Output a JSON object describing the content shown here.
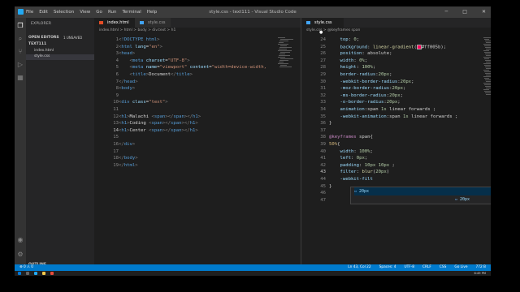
{
  "window": {
    "title": "style.css - text111 - Visual Studio Code",
    "menu": [
      "File",
      "Edit",
      "Selection",
      "View",
      "Go",
      "Run",
      "Terminal",
      "Help"
    ]
  },
  "sidebar": {
    "header": "EXPLORER",
    "open_editors": "OPEN EDITORS",
    "unsaved": "1 UNSAVED",
    "folder": "TEXT111",
    "files": [
      "index.html",
      "style.css"
    ],
    "outline": "OUTLINE"
  },
  "left_editor": {
    "tabs": [
      "index.html",
      "style.css"
    ],
    "breadcrumb": "index.html > html > body > div.text > h1",
    "lines": [
      {
        "n": "1",
        "parts": [
          [
            "punc",
            "<"
          ],
          [
            "tag",
            "!DOCTYPE html"
          ],
          [
            "punc",
            ">"
          ]
        ]
      },
      {
        "n": "2",
        "parts": [
          [
            "punc",
            "<"
          ],
          [
            "tag",
            "html "
          ],
          [
            "attr",
            "lang"
          ],
          [
            "plain",
            "="
          ],
          [
            "str",
            "\"en\""
          ],
          [
            "punc",
            ">"
          ]
        ]
      },
      {
        "n": "3",
        "parts": [
          [
            "punc",
            "<"
          ],
          [
            "tag",
            "head"
          ],
          [
            "punc",
            ">"
          ]
        ]
      },
      {
        "n": "4",
        "parts": [
          [
            "plain",
            "    "
          ],
          [
            "punc",
            "<"
          ],
          [
            "tag",
            "meta "
          ],
          [
            "attr",
            "charset"
          ],
          [
            "plain",
            "="
          ],
          [
            "str",
            "\"UTF-8\""
          ],
          [
            "punc",
            ">"
          ]
        ]
      },
      {
        "n": "5",
        "parts": [
          [
            "plain",
            "    "
          ],
          [
            "punc",
            "<"
          ],
          [
            "tag",
            "meta "
          ],
          [
            "attr",
            "name"
          ],
          [
            "plain",
            "="
          ],
          [
            "str",
            "\"viewport\""
          ],
          [
            "plain",
            " "
          ],
          [
            "attr",
            "content"
          ],
          [
            "plain",
            "="
          ],
          [
            "str",
            "\"width=device-width,"
          ]
        ]
      },
      {
        "n": "6",
        "parts": [
          [
            "plain",
            "    "
          ],
          [
            "punc",
            "<"
          ],
          [
            "tag",
            "title"
          ],
          [
            "punc",
            ">"
          ],
          [
            "plain",
            "Document"
          ],
          [
            "punc",
            "</"
          ],
          [
            "tag",
            "title"
          ],
          [
            "punc",
            ">"
          ]
        ]
      },
      {
        "n": "7",
        "parts": [
          [
            "punc",
            "</"
          ],
          [
            "tag",
            "head"
          ],
          [
            "punc",
            ">"
          ]
        ]
      },
      {
        "n": "8",
        "parts": [
          [
            "punc",
            "<"
          ],
          [
            "tag",
            "body"
          ],
          [
            "punc",
            ">"
          ]
        ]
      },
      {
        "n": "9",
        "parts": []
      },
      {
        "n": "10",
        "parts": [
          [
            "punc",
            "<"
          ],
          [
            "tag",
            "div "
          ],
          [
            "attr",
            "class"
          ],
          [
            "plain",
            "="
          ],
          [
            "str",
            "\"text\""
          ],
          [
            "punc",
            ">"
          ]
        ]
      },
      {
        "n": "11",
        "parts": []
      },
      {
        "n": "12",
        "parts": [
          [
            "punc",
            "<"
          ],
          [
            "tag",
            "h1"
          ],
          [
            "punc",
            ">"
          ],
          [
            "plain",
            "Malachi "
          ],
          [
            "punc",
            "<"
          ],
          [
            "tag",
            "span"
          ],
          [
            "punc",
            "></"
          ],
          [
            "tag",
            "span"
          ],
          [
            "punc",
            "></"
          ],
          [
            "tag",
            "h1"
          ],
          [
            "punc",
            ">"
          ]
        ]
      },
      {
        "n": "13",
        "parts": [
          [
            "punc",
            "<"
          ],
          [
            "tag",
            "h1"
          ],
          [
            "punc",
            ">"
          ],
          [
            "plain",
            "Coding "
          ],
          [
            "punc",
            "<"
          ],
          [
            "tag",
            "span"
          ],
          [
            "punc",
            "></"
          ],
          [
            "tag",
            "span"
          ],
          [
            "punc",
            "></"
          ],
          [
            "tag",
            "h1"
          ],
          [
            "punc",
            ">"
          ]
        ]
      },
      {
        "n": "14",
        "parts": [
          [
            "punc",
            "<"
          ],
          [
            "tag",
            "h1"
          ],
          [
            "punc",
            ">"
          ],
          [
            "plain",
            "Center "
          ],
          [
            "punc",
            "<"
          ],
          [
            "tag",
            "span"
          ],
          [
            "punc",
            "></"
          ],
          [
            "tag",
            "span"
          ],
          [
            "punc",
            "></"
          ],
          [
            "tag",
            "h1"
          ],
          [
            "punc",
            ">"
          ]
        ]
      },
      {
        "n": "15",
        "parts": []
      },
      {
        "n": "16",
        "parts": [
          [
            "punc",
            "</"
          ],
          [
            "tag",
            "div"
          ],
          [
            "punc",
            ">"
          ]
        ]
      },
      {
        "n": "17",
        "parts": []
      },
      {
        "n": "18",
        "parts": [
          [
            "punc",
            "</"
          ],
          [
            "tag",
            "body"
          ],
          [
            "punc",
            ">"
          ]
        ]
      },
      {
        "n": "19",
        "parts": [
          [
            "punc",
            "</"
          ],
          [
            "tag",
            "html"
          ],
          [
            "punc",
            ">"
          ]
        ]
      }
    ]
  },
  "right_editor": {
    "tab": "style.css",
    "breadcrumb": "style.css > @keyframes span",
    "lines": [
      {
        "n": "24",
        "parts": [
          [
            "prop",
            "    top"
          ],
          [
            "plain",
            ": "
          ],
          [
            "num",
            "0"
          ],
          [
            "plain",
            ";"
          ]
        ]
      },
      {
        "n": "25",
        "parts": [
          [
            "prop",
            "    background"
          ],
          [
            "plain",
            ": "
          ],
          [
            "fn",
            "linear-gradient"
          ],
          [
            "plain",
            "("
          ],
          [
            "swatch",
            ""
          ],
          [
            "plain",
            "#ff005b);"
          ]
        ]
      },
      {
        "n": "26",
        "parts": [
          [
            "prop",
            "    position"
          ],
          [
            "plain",
            ": absolute;"
          ]
        ]
      },
      {
        "n": "27",
        "parts": [
          [
            "prop",
            "    width"
          ],
          [
            "plain",
            ": "
          ],
          [
            "num",
            "0%"
          ],
          [
            "plain",
            ";"
          ]
        ]
      },
      {
        "n": "28",
        "parts": [
          [
            "prop",
            "    height"
          ],
          [
            "plain",
            ": "
          ],
          [
            "num",
            "100%"
          ],
          [
            "plain",
            ";"
          ]
        ]
      },
      {
        "n": "29",
        "parts": [
          [
            "prop",
            "    border-radius"
          ],
          [
            "plain",
            ":"
          ],
          [
            "num",
            "20px"
          ],
          [
            "plain",
            ";"
          ]
        ]
      },
      {
        "n": "30",
        "parts": [
          [
            "prop",
            "    -webkit-border-radius"
          ],
          [
            "plain",
            ":"
          ],
          [
            "num",
            "20px"
          ],
          [
            "plain",
            ";"
          ]
        ]
      },
      {
        "n": "31",
        "parts": [
          [
            "prop",
            "    -moz-border-radius"
          ],
          [
            "plain",
            ":"
          ],
          [
            "num",
            "20px"
          ],
          [
            "plain",
            ";"
          ]
        ]
      },
      {
        "n": "32",
        "parts": [
          [
            "prop",
            "    -ms-border-radius"
          ],
          [
            "plain",
            ":"
          ],
          [
            "num",
            "20px"
          ],
          [
            "plain",
            ";"
          ]
        ]
      },
      {
        "n": "33",
        "parts": [
          [
            "prop",
            "    -o-border-radius"
          ],
          [
            "plain",
            ":"
          ],
          [
            "num",
            "20px"
          ],
          [
            "plain",
            ";"
          ]
        ]
      },
      {
        "n": "34",
        "parts": [
          [
            "prop",
            "    animation"
          ],
          [
            "plain",
            ":span "
          ],
          [
            "num",
            "1s"
          ],
          [
            "plain",
            " linear forwards ;"
          ]
        ]
      },
      {
        "n": "35",
        "parts": [
          [
            "prop",
            "    -webkit-animation"
          ],
          [
            "plain",
            ":span "
          ],
          [
            "num",
            "1s"
          ],
          [
            "plain",
            " linear forwards ;"
          ]
        ]
      },
      {
        "n": "36",
        "parts": [
          [
            "plain",
            "}"
          ]
        ]
      },
      {
        "n": "37",
        "parts": []
      },
      {
        "n": "38",
        "parts": [
          [
            "kw",
            "@keyframes"
          ],
          [
            "plain",
            " span{"
          ]
        ]
      },
      {
        "n": "39",
        "parts": [
          [
            "sel",
            "50%"
          ],
          [
            "plain",
            "{"
          ]
        ]
      },
      {
        "n": "40",
        "parts": [
          [
            "prop",
            "    width"
          ],
          [
            "plain",
            ": "
          ],
          [
            "num",
            "100%"
          ],
          [
            "plain",
            ";"
          ]
        ]
      },
      {
        "n": "41",
        "parts": [
          [
            "prop",
            "    left"
          ],
          [
            "plain",
            ": "
          ],
          [
            "num",
            "0px"
          ],
          [
            "plain",
            ";"
          ]
        ]
      },
      {
        "n": "42",
        "parts": [
          [
            "prop",
            "    padding"
          ],
          [
            "plain",
            ": "
          ],
          [
            "num",
            "10px 10px"
          ],
          [
            "plain",
            " ;"
          ]
        ]
      },
      {
        "n": "43",
        "parts": [
          [
            "prop",
            "    filter"
          ],
          [
            "plain",
            ": "
          ],
          [
            "fn",
            "blur"
          ],
          [
            "plain",
            "("
          ],
          [
            "num",
            "20px"
          ],
          [
            "plain",
            ")"
          ]
        ]
      },
      {
        "n": "44",
        "parts": [
          [
            "prop",
            "    -webkit-filt"
          ]
        ]
      },
      {
        "n": "45",
        "parts": [
          [
            "plain",
            "}"
          ]
        ]
      },
      {
        "n": "46",
        "parts": []
      },
      {
        "n": "47",
        "parts": []
      }
    ],
    "suggestions": [
      "20px",
      "20px"
    ]
  },
  "statusbar": {
    "left": [
      "⊗ 0 ⚠ 0"
    ],
    "right": [
      "Ln 43, Col 22",
      "Spaces: 4",
      "UTF-8",
      "CRLF",
      "CSS",
      "Go Live",
      "772 B"
    ]
  },
  "clock": "6:49 PM"
}
